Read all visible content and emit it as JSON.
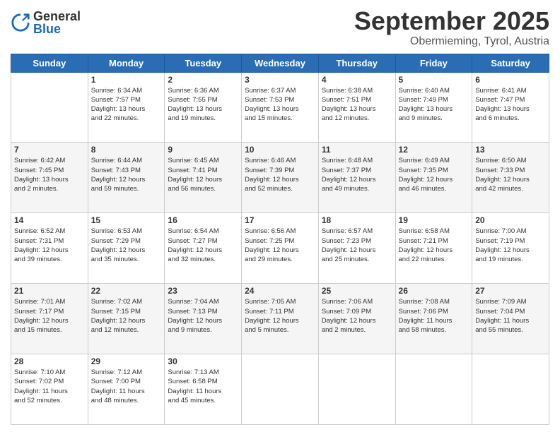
{
  "header": {
    "logo": {
      "general": "General",
      "blue": "Blue"
    },
    "title": "September 2025",
    "location": "Obermieming, Tyrol, Austria"
  },
  "weekdays": [
    "Sunday",
    "Monday",
    "Tuesday",
    "Wednesday",
    "Thursday",
    "Friday",
    "Saturday"
  ],
  "weeks": [
    [
      {
        "day": "",
        "info": ""
      },
      {
        "day": "1",
        "info": "Sunrise: 6:34 AM\nSunset: 7:57 PM\nDaylight: 13 hours\nand 22 minutes."
      },
      {
        "day": "2",
        "info": "Sunrise: 6:36 AM\nSunset: 7:55 PM\nDaylight: 13 hours\nand 19 minutes."
      },
      {
        "day": "3",
        "info": "Sunrise: 6:37 AM\nSunset: 7:53 PM\nDaylight: 13 hours\nand 15 minutes."
      },
      {
        "day": "4",
        "info": "Sunrise: 6:38 AM\nSunset: 7:51 PM\nDaylight: 13 hours\nand 12 minutes."
      },
      {
        "day": "5",
        "info": "Sunrise: 6:40 AM\nSunset: 7:49 PM\nDaylight: 13 hours\nand 9 minutes."
      },
      {
        "day": "6",
        "info": "Sunrise: 6:41 AM\nSunset: 7:47 PM\nDaylight: 13 hours\nand 6 minutes."
      }
    ],
    [
      {
        "day": "7",
        "info": "Sunrise: 6:42 AM\nSunset: 7:45 PM\nDaylight: 13 hours\nand 2 minutes."
      },
      {
        "day": "8",
        "info": "Sunrise: 6:44 AM\nSunset: 7:43 PM\nDaylight: 12 hours\nand 59 minutes."
      },
      {
        "day": "9",
        "info": "Sunrise: 6:45 AM\nSunset: 7:41 PM\nDaylight: 12 hours\nand 56 minutes."
      },
      {
        "day": "10",
        "info": "Sunrise: 6:46 AM\nSunset: 7:39 PM\nDaylight: 12 hours\nand 52 minutes."
      },
      {
        "day": "11",
        "info": "Sunrise: 6:48 AM\nSunset: 7:37 PM\nDaylight: 12 hours\nand 49 minutes."
      },
      {
        "day": "12",
        "info": "Sunrise: 6:49 AM\nSunset: 7:35 PM\nDaylight: 12 hours\nand 46 minutes."
      },
      {
        "day": "13",
        "info": "Sunrise: 6:50 AM\nSunset: 7:33 PM\nDaylight: 12 hours\nand 42 minutes."
      }
    ],
    [
      {
        "day": "14",
        "info": "Sunrise: 6:52 AM\nSunset: 7:31 PM\nDaylight: 12 hours\nand 39 minutes."
      },
      {
        "day": "15",
        "info": "Sunrise: 6:53 AM\nSunset: 7:29 PM\nDaylight: 12 hours\nand 35 minutes."
      },
      {
        "day": "16",
        "info": "Sunrise: 6:54 AM\nSunset: 7:27 PM\nDaylight: 12 hours\nand 32 minutes."
      },
      {
        "day": "17",
        "info": "Sunrise: 6:56 AM\nSunset: 7:25 PM\nDaylight: 12 hours\nand 29 minutes."
      },
      {
        "day": "18",
        "info": "Sunrise: 6:57 AM\nSunset: 7:23 PM\nDaylight: 12 hours\nand 25 minutes."
      },
      {
        "day": "19",
        "info": "Sunrise: 6:58 AM\nSunset: 7:21 PM\nDaylight: 12 hours\nand 22 minutes."
      },
      {
        "day": "20",
        "info": "Sunrise: 7:00 AM\nSunset: 7:19 PM\nDaylight: 12 hours\nand 19 minutes."
      }
    ],
    [
      {
        "day": "21",
        "info": "Sunrise: 7:01 AM\nSunset: 7:17 PM\nDaylight: 12 hours\nand 15 minutes."
      },
      {
        "day": "22",
        "info": "Sunrise: 7:02 AM\nSunset: 7:15 PM\nDaylight: 12 hours\nand 12 minutes."
      },
      {
        "day": "23",
        "info": "Sunrise: 7:04 AM\nSunset: 7:13 PM\nDaylight: 12 hours\nand 9 minutes."
      },
      {
        "day": "24",
        "info": "Sunrise: 7:05 AM\nSunset: 7:11 PM\nDaylight: 12 hours\nand 5 minutes."
      },
      {
        "day": "25",
        "info": "Sunrise: 7:06 AM\nSunset: 7:09 PM\nDaylight: 12 hours\nand 2 minutes."
      },
      {
        "day": "26",
        "info": "Sunrise: 7:08 AM\nSunset: 7:06 PM\nDaylight: 11 hours\nand 58 minutes."
      },
      {
        "day": "27",
        "info": "Sunrise: 7:09 AM\nSunset: 7:04 PM\nDaylight: 11 hours\nand 55 minutes."
      }
    ],
    [
      {
        "day": "28",
        "info": "Sunrise: 7:10 AM\nSunset: 7:02 PM\nDaylight: 11 hours\nand 52 minutes."
      },
      {
        "day": "29",
        "info": "Sunrise: 7:12 AM\nSunset: 7:00 PM\nDaylight: 11 hours\nand 48 minutes."
      },
      {
        "day": "30",
        "info": "Sunrise: 7:13 AM\nSunset: 6:58 PM\nDaylight: 11 hours\nand 45 minutes."
      },
      {
        "day": "",
        "info": ""
      },
      {
        "day": "",
        "info": ""
      },
      {
        "day": "",
        "info": ""
      },
      {
        "day": "",
        "info": ""
      }
    ]
  ]
}
